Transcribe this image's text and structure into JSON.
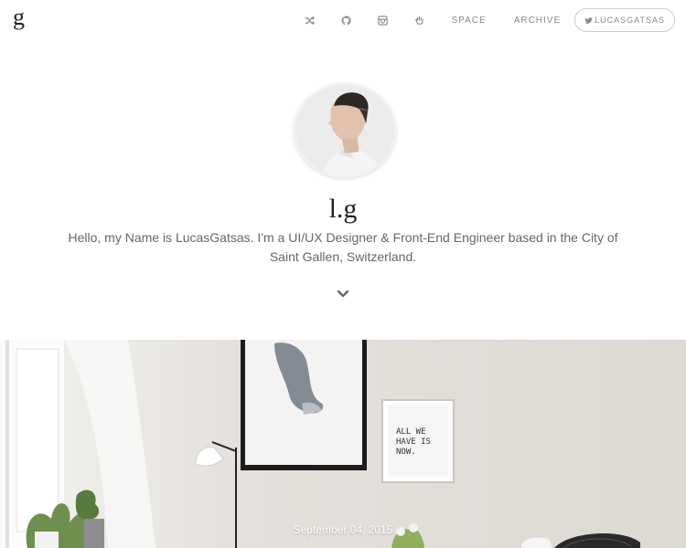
{
  "header": {
    "logo": "g",
    "nav_icons": [
      {
        "name": "shuffle-icon"
      },
      {
        "name": "github-icon"
      },
      {
        "name": "instagram-icon"
      },
      {
        "name": "hand-icon"
      }
    ],
    "nav_links": [
      "SPACE",
      "ARCHIVE"
    ],
    "twitter_label": "LUCASGATSAS"
  },
  "profile": {
    "title": "l.g",
    "bio": "Hello, my Name is LucasGatsas. I'm a UI/UX Designer & Front-End Engineer based in the City of Saint Gallen, Switzerland."
  },
  "hero": {
    "date": "September 04, 2015",
    "poster_text": [
      "ALL WE",
      "HAVE IS",
      "NOW."
    ]
  },
  "colors": {
    "text": "#555555",
    "muted": "#8a8a8a",
    "title": "#222222"
  }
}
